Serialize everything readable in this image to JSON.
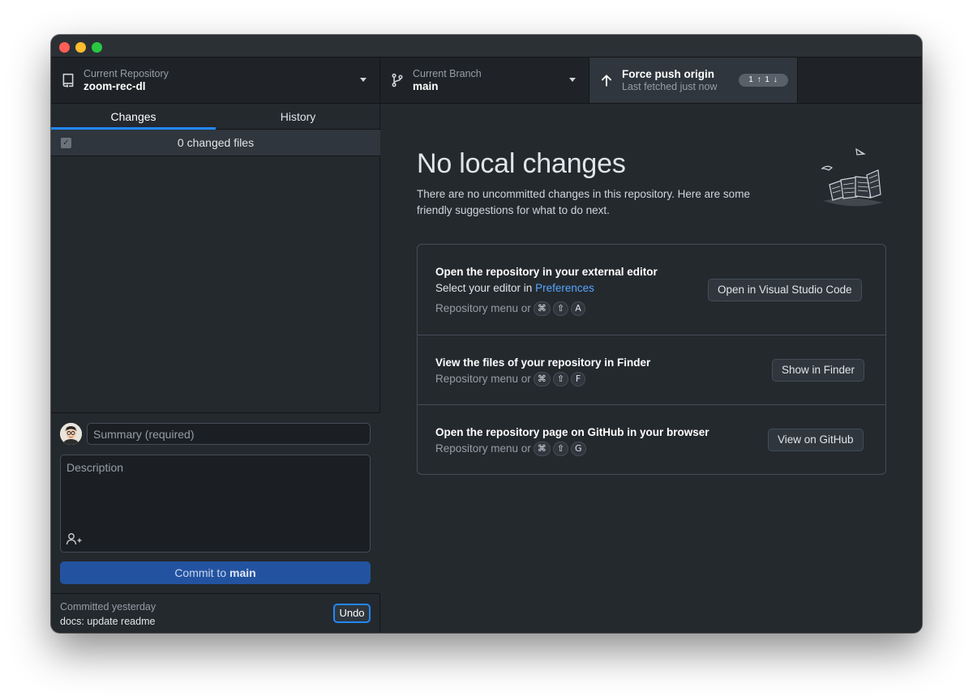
{
  "toolbar": {
    "repository": {
      "label": "Current Repository",
      "value": "zoom-rec-dl"
    },
    "branch": {
      "label": "Current Branch",
      "value": "main"
    },
    "push": {
      "label": "Force push origin",
      "sub": "Last fetched just now",
      "badge": "1 ↑ 1 ↓"
    }
  },
  "sidebar": {
    "tabs": [
      {
        "label": "Changes",
        "selected": true
      },
      {
        "label": "History",
        "selected": false
      }
    ],
    "changed_files": "0 changed files",
    "summary_placeholder": "Summary (required)",
    "description_placeholder": "Description",
    "commit_button": {
      "prefix": "Commit to",
      "branch": "main"
    },
    "last_commit": {
      "when": "Committed yesterday",
      "message": "docs: update readme",
      "undo_label": "Undo"
    }
  },
  "main": {
    "title": "No local changes",
    "subtitle": "There are no uncommitted changes in this repository. Here are some friendly suggestions for what to do next.",
    "suggestions": [
      {
        "title": "Open the repository in your external editor",
        "line_prefix": "Select your editor in",
        "line_link": "Preferences",
        "hint": "Repository menu or",
        "keys": [
          "⌘",
          "⇧",
          "A"
        ],
        "button": "Open in Visual Studio Code"
      },
      {
        "title": "View the files of your repository in Finder",
        "hint": "Repository menu or",
        "keys": [
          "⌘",
          "⇧",
          "F"
        ],
        "button": "Show in Finder"
      },
      {
        "title": "Open the repository page on GitHub in your browser",
        "hint": "Repository menu or",
        "keys": [
          "⌘",
          "⇧",
          "G"
        ],
        "button": "View on GitHub"
      }
    ]
  },
  "colors": {
    "accent": "#2188ff",
    "commit_button": "#2353a0",
    "link": "#58a6ff",
    "background": "#24292e"
  }
}
